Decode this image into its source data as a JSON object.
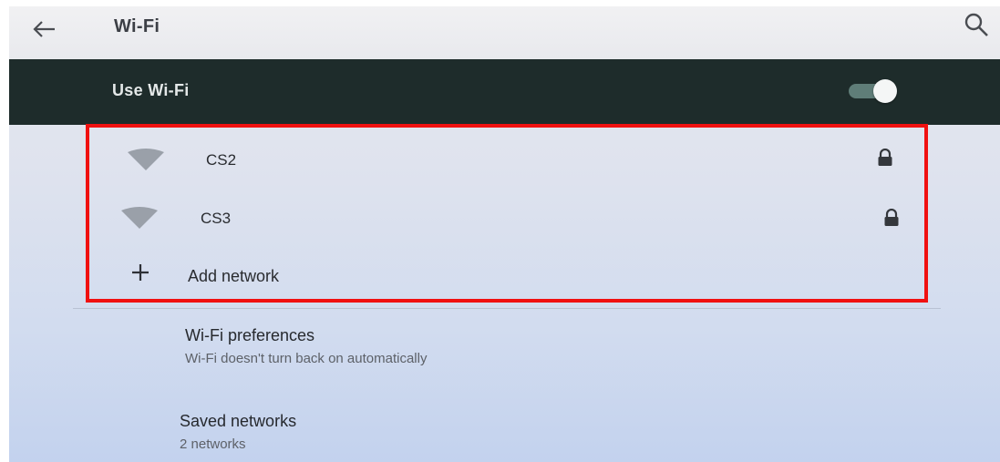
{
  "app_bar": {
    "title": "Wi-Fi",
    "back_icon": "arrow-left-icon",
    "search_icon": "search-icon"
  },
  "master_switch": {
    "label": "Use Wi-Fi",
    "state": "on"
  },
  "networks": [
    {
      "name": "CS2",
      "signal_icon": "wifi-signal-icon",
      "secured": true
    },
    {
      "name": "CS3",
      "signal_icon": "wifi-signal-icon",
      "secured": true
    }
  ],
  "add_network": {
    "label": "Add network",
    "icon": "plus-icon"
  },
  "preferences": [
    {
      "title": "Wi-Fi preferences",
      "subtitle": "Wi-Fi doesn't turn back on automatically"
    },
    {
      "title": "Saved networks",
      "subtitle": "2 networks"
    }
  ],
  "colors": {
    "master_bar": "#1e2c2b",
    "highlight_box": "#f01010",
    "toggle_thumb": "#f4f6f6",
    "toggle_track": "#5f7d78"
  }
}
